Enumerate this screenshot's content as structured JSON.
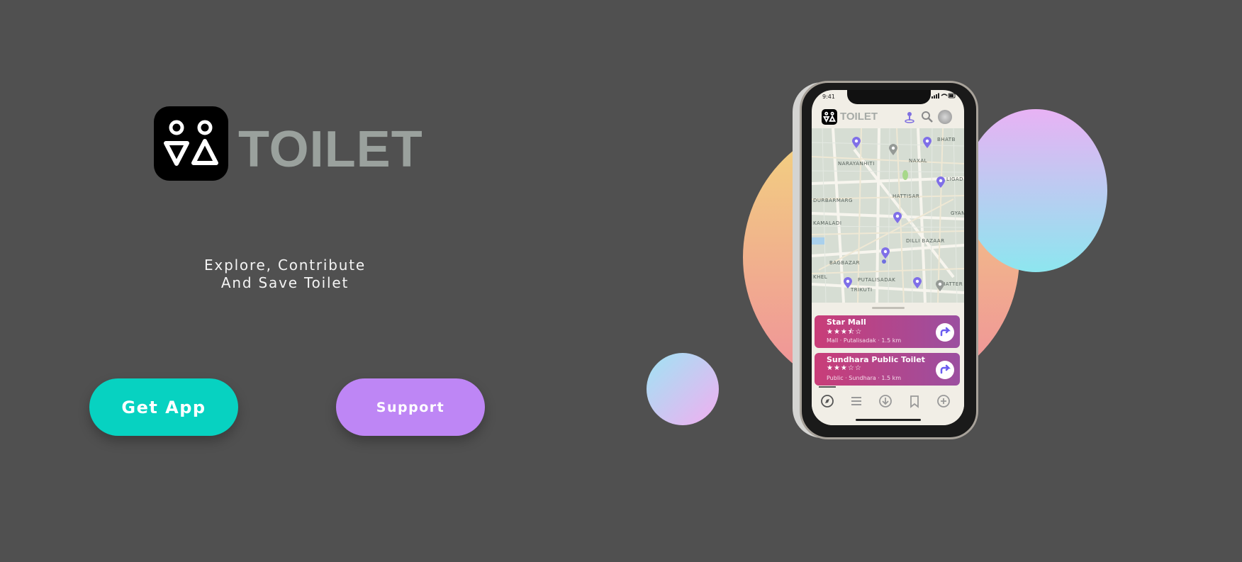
{
  "hero": {
    "brand": "TOILET",
    "tagline_line1": "Explore, Contribute",
    "tagline_line2": "And Save Toilet"
  },
  "actions": {
    "get_app_label": "Get App",
    "support_label": "Support"
  },
  "colors": {
    "background": "#505050",
    "get_app": "#07d2c1",
    "support": "#be86f5",
    "brand_text": "#9aa19d"
  },
  "phone": {
    "status_time": "9:41",
    "app_title": "TOILET",
    "header_icons": [
      "person-pin-icon",
      "search-icon",
      "avatar"
    ],
    "map_labels": [
      "NARAYANHITI",
      "NAXAL",
      "BHATB",
      "LIGAD",
      "HATTISAR",
      "DURBARMARG",
      "GYAN",
      "KAMALADI",
      "DILLI BAZAAR",
      "BAGBAZAR",
      "PUTALISADAK",
      "KHEL",
      "SHATTER",
      "TRIKUTI"
    ],
    "cards": [
      {
        "name": "Star Mall",
        "stars": "★★★⯪☆",
        "meta": "Mall · Putalisadak · 1.5 km"
      },
      {
        "name": "Sundhara Public Toilet",
        "stars": "★★★☆☆",
        "meta": "Public · Sundhara · 1.5 km"
      }
    ],
    "tabs": [
      "compass-icon",
      "list-icon",
      "download-icon",
      "bookmark-icon",
      "add-icon"
    ]
  }
}
